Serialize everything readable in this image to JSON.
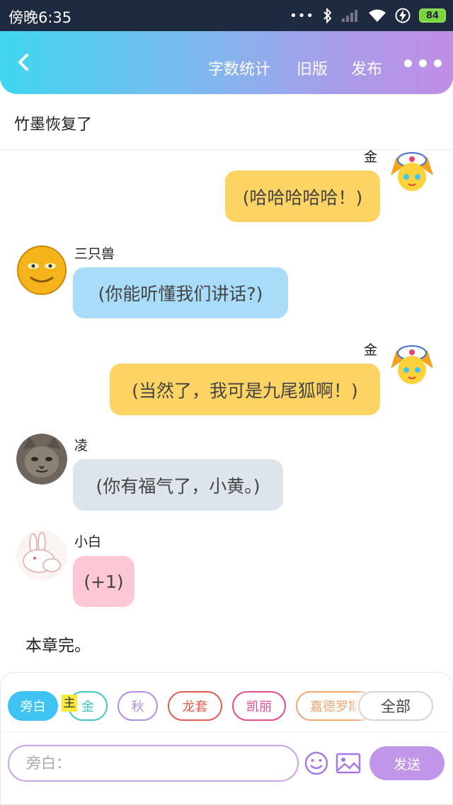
{
  "status_bar": {
    "time": "傍晚6:35",
    "battery": "84"
  },
  "header": {
    "actions": [
      "字数统计",
      "旧版",
      "发布"
    ]
  },
  "chapter": {
    "title": "竹墨恢复了"
  },
  "messages": [
    {
      "speaker": "金",
      "text": "(哈哈哈哈哈！)",
      "side": "right",
      "color": "#fdd364"
    },
    {
      "speaker": "三只兽",
      "text": "(你能听懂我们讲话?)",
      "side": "left",
      "color": "#a8dcf8"
    },
    {
      "speaker": "金",
      "text": "(当然了，我可是九尾狐啊！)",
      "side": "right",
      "color": "#fdd364"
    },
    {
      "speaker": "凌",
      "text": "(你有福气了，小黄。)",
      "side": "left",
      "color": "#dde4ec"
    },
    {
      "speaker": "小白",
      "text": "(+1)",
      "side": "left",
      "color": "#fdc7d3"
    }
  ],
  "end_text": "本章完。",
  "composer": {
    "main_tag": "主",
    "roles": [
      {
        "label": "旁白",
        "color": "#3fc3f2",
        "selected": true
      },
      {
        "label": "金",
        "color": "#3fc8c0"
      },
      {
        "label": "秋",
        "color": "#b48de4"
      },
      {
        "label": "龙套",
        "color": "#e35b4f"
      },
      {
        "label": "凯丽",
        "color": "#e24b8f"
      },
      {
        "label": "嘉德罗斯",
        "color": "#f0a774"
      }
    ],
    "all_label": "全部",
    "input_placeholder": "旁白：",
    "send_label": "发送"
  }
}
